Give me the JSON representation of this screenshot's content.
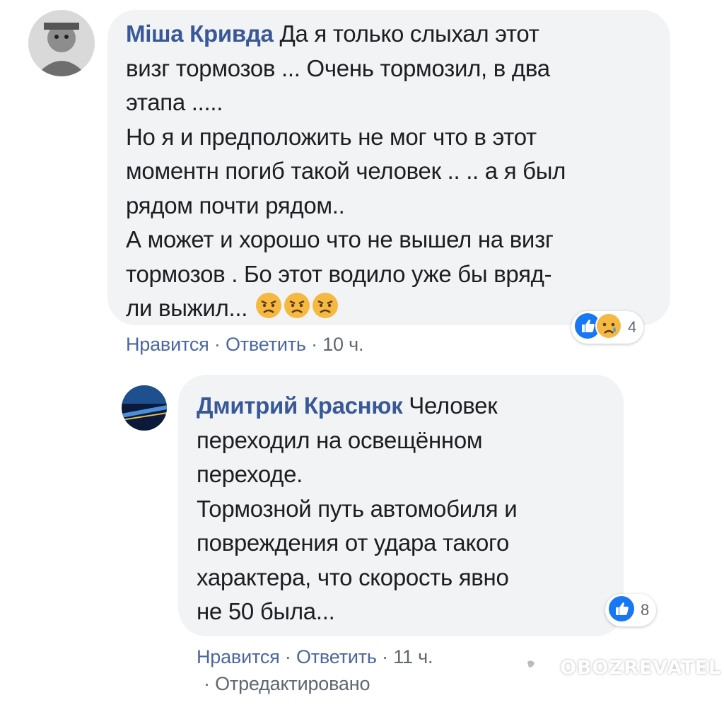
{
  "comments": [
    {
      "author": "Міша Кривда",
      "lines": [
        "Да я только слыхал этот",
        "визг тормозов ... Очень тормозил, в два",
        "этапа .....",
        "Но я и предположить не мог что в этот",
        "моментн погиб такой человек .. .. а я был",
        "рядом почти рядом..",
        "А может и хорошо что не вышел на визг",
        "тормозов . Бо этот водило уже бы вряд-",
        "ли выжил..."
      ],
      "inline_emoji": [
        "angry-face-icon",
        "angry-face-icon",
        "angry-face-icon"
      ],
      "actions": {
        "like": "Нравится",
        "reply": "Ответить",
        "time": "10 ч.",
        "sep": "·"
      },
      "reactions": {
        "icons": [
          "like-icon",
          "crying-face-icon"
        ],
        "count": "4"
      }
    },
    {
      "author": "Дмитрий Краснюк",
      "lines": [
        "Человек",
        "переходил на освещённом",
        "переходе.",
        "Тормозной путь автомобиля и",
        "повреждения от удара такого",
        "характера, что скорость явно",
        "не 50 была..."
      ],
      "actions": {
        "like": "Нравится",
        "reply": "Ответить",
        "time": "11 ч.",
        "edited": "Отредактировано",
        "sep": "·"
      },
      "reactions": {
        "icons": [
          "like-icon"
        ],
        "count": "8"
      }
    }
  ],
  "watermark": {
    "text": "OBOZREVATEL"
  },
  "colors": {
    "author": "#385898",
    "bubble": "#f2f3f5",
    "like_blue": "#1877f2",
    "meta": "#606770"
  }
}
